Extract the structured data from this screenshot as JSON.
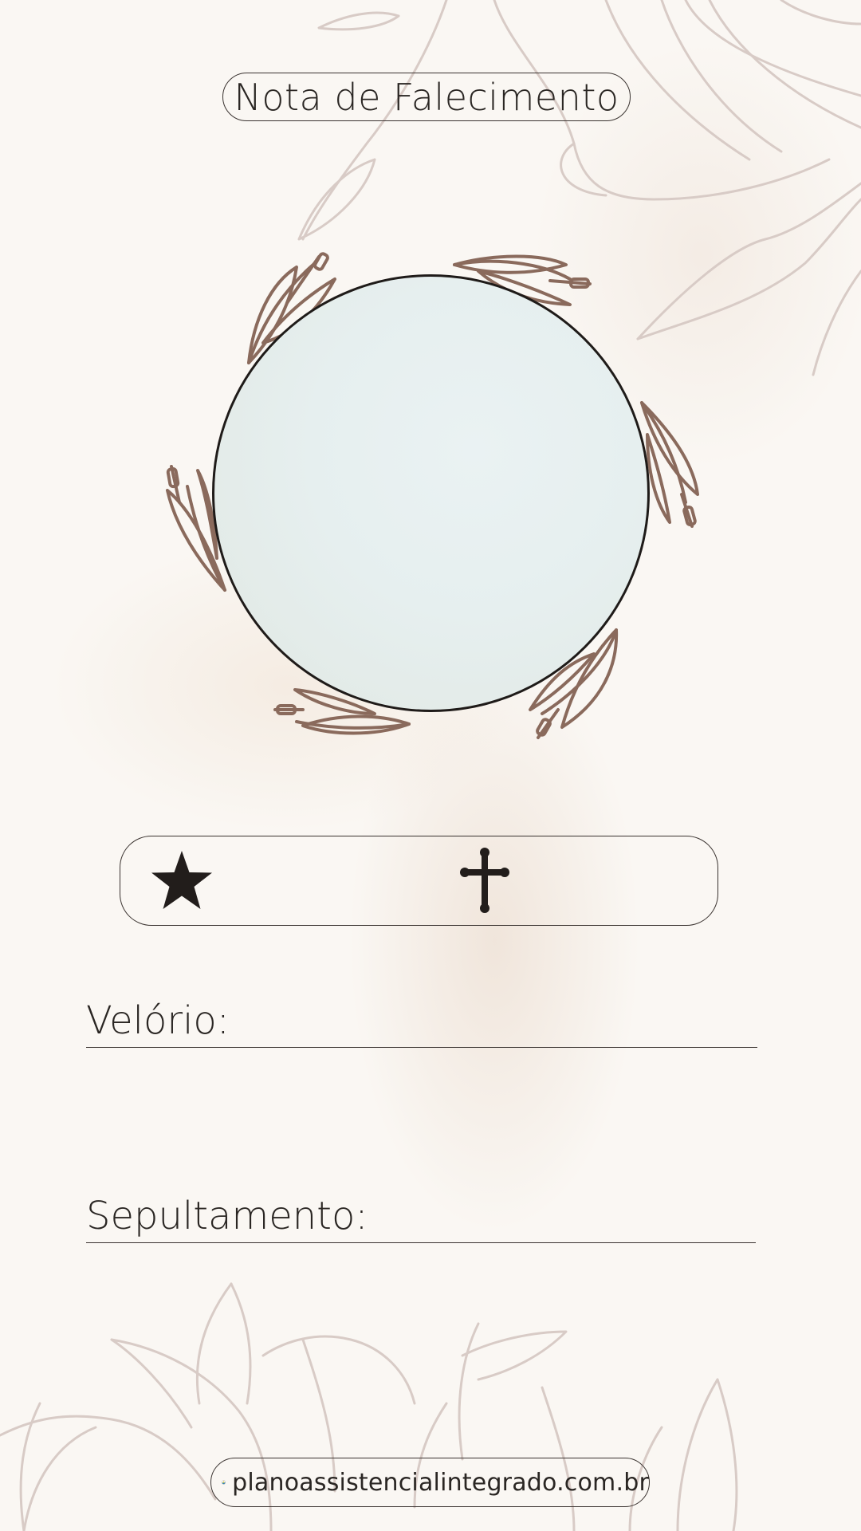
{
  "card": {
    "title": "Nota de Falecimento",
    "birth_symbol": "star-icon",
    "death_symbol": "cross-icon"
  },
  "fields": {
    "wake_label": "Velório:",
    "burial_label": "Sepultamento:"
  },
  "footer": {
    "website": "planoassistencialintegrado.com.br"
  },
  "colors": {
    "background": "#faf7f3",
    "ink": "#2a2623",
    "leaf": "#8a6a5c",
    "floral_outline": "#d8cbc6",
    "photo_fill": "#e6efef"
  }
}
